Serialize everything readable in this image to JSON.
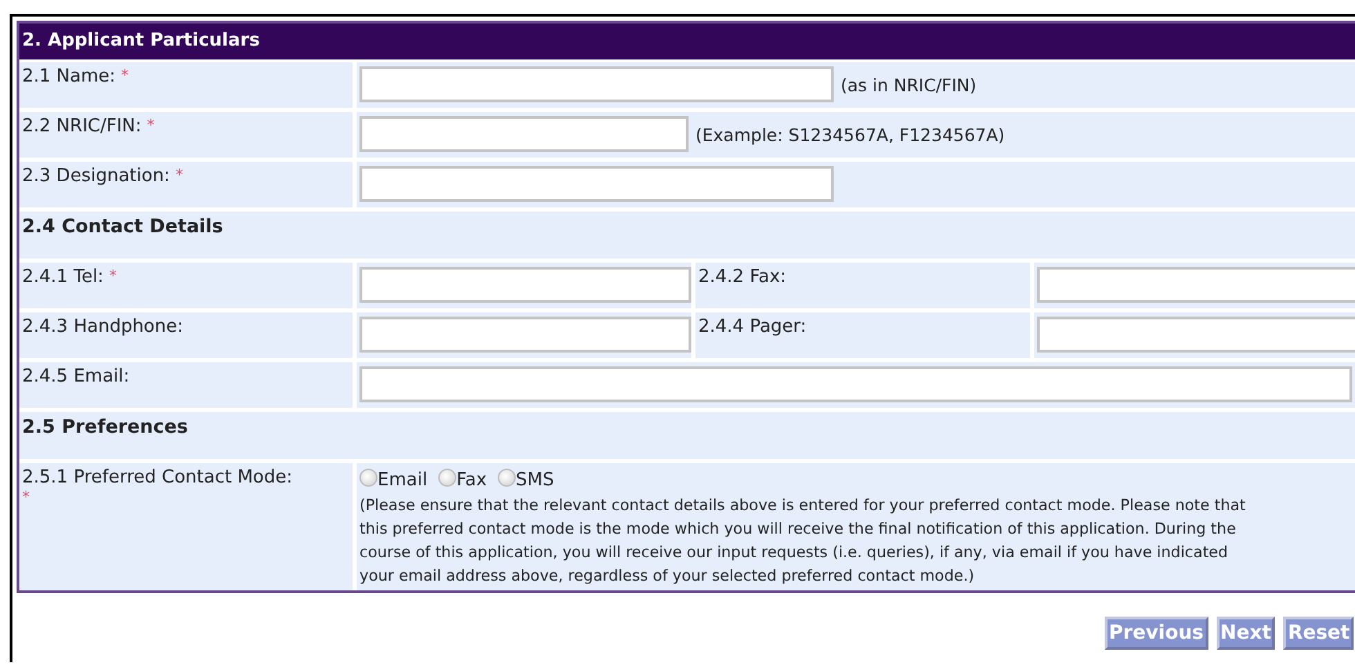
{
  "section": {
    "title": "2. Applicant Particulars"
  },
  "rows": [
    {
      "kind": "field",
      "label": "2.1 Name:",
      "required_mark": "*",
      "hint": "(as in NRIC/FIN)"
    },
    {
      "kind": "shortfield",
      "label": "2.2 NRIC/FIN:",
      "required_mark": "*",
      "hint": "(Example: S1234567A, F1234567A)"
    },
    {
      "kind": "field",
      "label": "2.3 Designation:",
      "required_mark": "*"
    },
    {
      "kind": "heading",
      "label": "2.4 Contact Details"
    },
    {
      "kind": "pair",
      "label": "2.4.1 Tel:",
      "required_mark": "*",
      "label_2": "2.4.2 Fax:"
    },
    {
      "kind": "pair",
      "label": "2.4.3 Handphone:",
      "label_2": "2.4.4 Pager:"
    },
    {
      "kind": "wide",
      "label": "2.4.5 Email:"
    },
    {
      "kind": "heading",
      "label": "2.5 Preferences"
    },
    {
      "kind": "radio",
      "label": "2.5.1 Preferred Contact Mode:",
      "required_mark": "*",
      "options": [
        {
          "label": "Email",
          "selected": false
        },
        {
          "label": "Fax",
          "selected": false
        },
        {
          "label": "SMS",
          "selected": false
        }
      ],
      "note": "(Please ensure that the relevant contact details above is entered for your preferred contact mode. Please note that\nthis preferred contact mode is the mode which you will receive the final notification of this application. During the\ncourse of this application, you will receive our input requests (i.e. queries), if any, via email if you have indicated\nyour email address above, regardless of your selected preferred contact mode.)"
    }
  ],
  "buttons": [
    "Previous",
    "Next",
    "Reset"
  ]
}
